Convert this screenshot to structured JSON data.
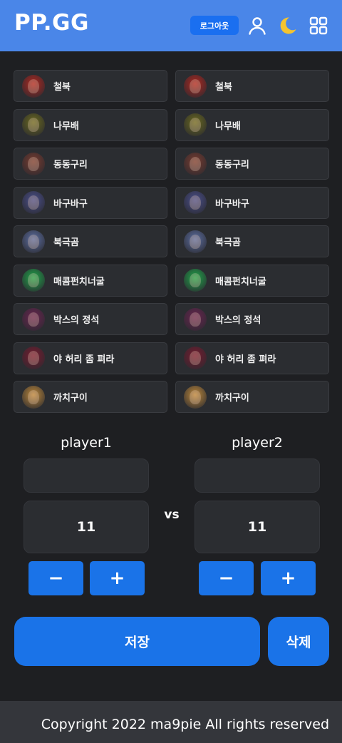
{
  "header": {
    "logo": "PP.GG",
    "logout_label": "로그아웃",
    "icons": [
      "user-icon",
      "moon-icon",
      "grid-icon"
    ],
    "accent": "#4a86e8",
    "moon_color": "#f4c430"
  },
  "champions": [
    {
      "label": "철북",
      "color": "#b3261e"
    },
    {
      "label": "나무배",
      "color": "#6b6a1d"
    },
    {
      "label": "동동구리",
      "color": "#7a3b2e"
    },
    {
      "label": "바구바구",
      "color": "#4a4f8c"
    },
    {
      "label": "북극곰",
      "color": "#5d6fa3"
    },
    {
      "label": "매콤펀치너굴",
      "color": "#1fa84a"
    },
    {
      "label": "박스의 정석",
      "color": "#6b2450"
    },
    {
      "label": "야 허리 좀 펴라",
      "color": "#7a1a2e"
    },
    {
      "label": "까치구이",
      "color": "#c08a3a"
    }
  ],
  "players": [
    {
      "label": "player1",
      "name_value": "",
      "score": "11",
      "minus": "−",
      "plus": "+"
    },
    {
      "label": "player2",
      "name_value": "",
      "score": "11",
      "minus": "−",
      "plus": "+"
    }
  ],
  "vs_label": "vs",
  "actions": {
    "save_label": "저장",
    "delete_label": "삭제",
    "button_color": "#1a73e8"
  },
  "footer": {
    "text": "Copyright 2022 ma9pie All rights reserved"
  }
}
